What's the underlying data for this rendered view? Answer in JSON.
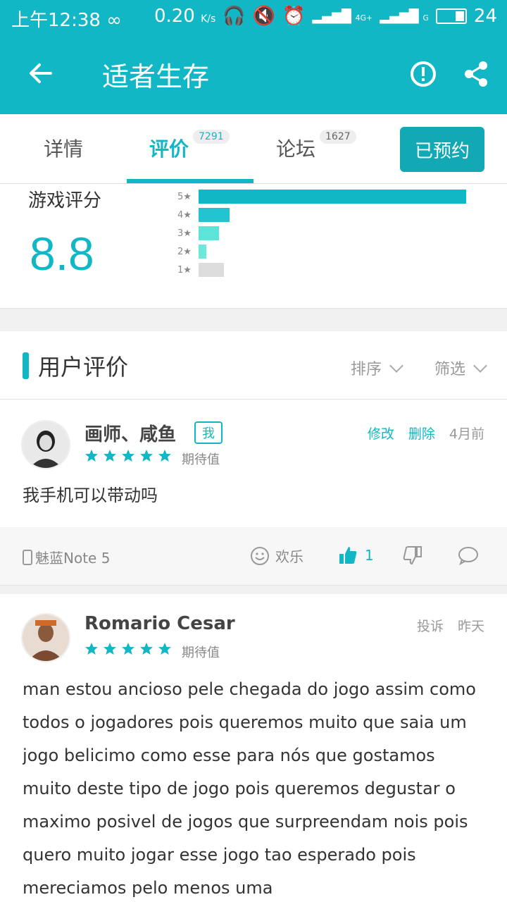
{
  "status": {
    "time": "上午12:38",
    "speed": "0.20",
    "speed_unit": "K/s",
    "net1": "4G+",
    "net2": "G",
    "battery": "24"
  },
  "appbar": {
    "title": "适者生存"
  },
  "tabs": [
    {
      "label": "详情",
      "count": ""
    },
    {
      "label": "评价",
      "count": "7291"
    },
    {
      "label": "论坛",
      "count": "1627"
    }
  ],
  "reserve_label": "已预约",
  "score": {
    "label": "游戏评分",
    "value": "8.8",
    "distribution": [
      {
        "stars": "5",
        "fraction": 1.0,
        "color": "#12b7c6"
      },
      {
        "stars": "4",
        "fraction": 0.115,
        "color": "#23c4d2"
      },
      {
        "stars": "3",
        "fraction": 0.075,
        "color": "#5de3d8"
      },
      {
        "stars": "2",
        "fraction": 0.03,
        "color": "#6ee8da"
      },
      {
        "stars": "1",
        "fraction": 0.095,
        "color": "#dddddd"
      }
    ]
  },
  "section": {
    "title": "用户评价",
    "sort": "排序",
    "filter": "筛选"
  },
  "reviews": [
    {
      "user": "画师、咸鱼",
      "badge": "我",
      "rating_label": "期待值",
      "edit": "修改",
      "delete": "删除",
      "time": "4月前",
      "text": "我手机可以带动吗",
      "device": "魅蓝Note 5",
      "mood": "欢乐",
      "likes": "1"
    },
    {
      "user": "Romario Cesar",
      "rating_label": "期待值",
      "report": "投诉",
      "time": "昨天",
      "text": "man estou ancioso pele chegada do jogo assim como todos o jogadores pois queremos muito que saia um jogo belicimo como esse para nós que gostamos muito deste tipo de jogo pois queremos degustar o maximo posivel de jogos que surpreendam nois pois quero muito jogar esse jogo tao esperado pois mereciamos pelo menos uma"
    }
  ],
  "colors": {
    "accent": "#12b7c6",
    "divider": "#e5e5e5"
  }
}
